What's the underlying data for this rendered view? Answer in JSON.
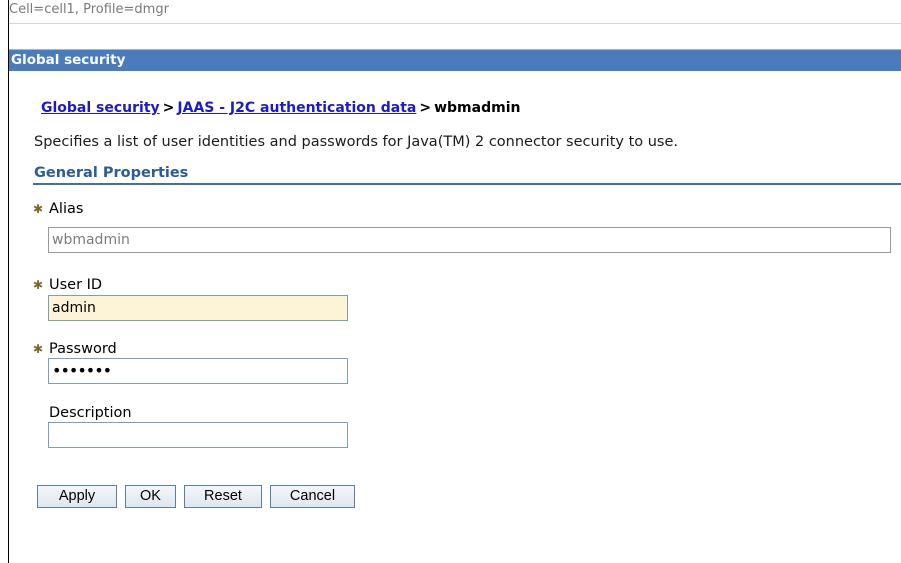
{
  "context": {
    "text": "Cell=cell1, Profile=dmgr"
  },
  "panel": {
    "title": "Global security"
  },
  "breadcrumb": {
    "items": [
      "Global security",
      "JAAS - J2C authentication data"
    ],
    "separator": ">",
    "current": "wbmadmin"
  },
  "description": "Specifies a list of user identities and passwords for Java(TM) 2 connector security to use.",
  "section": {
    "title": "General Properties"
  },
  "fields": {
    "alias": {
      "label": "Alias",
      "value": "wbmadmin",
      "required": true
    },
    "user_id": {
      "label": "User ID",
      "value": "admin",
      "required": true
    },
    "password": {
      "label": "Password",
      "value": "•••••••",
      "required": true
    },
    "description": {
      "label": "Description",
      "value": "",
      "required": false
    }
  },
  "buttons": {
    "apply": "Apply",
    "ok": "OK",
    "reset": "Reset",
    "cancel": "Cancel"
  },
  "icons": {
    "required": "required-field-icon"
  },
  "colors": {
    "title_bar": "#4a7cbd",
    "link": "#1a1acc",
    "section_title": "#2b5c96",
    "focused_field": "#fdf3d6"
  }
}
